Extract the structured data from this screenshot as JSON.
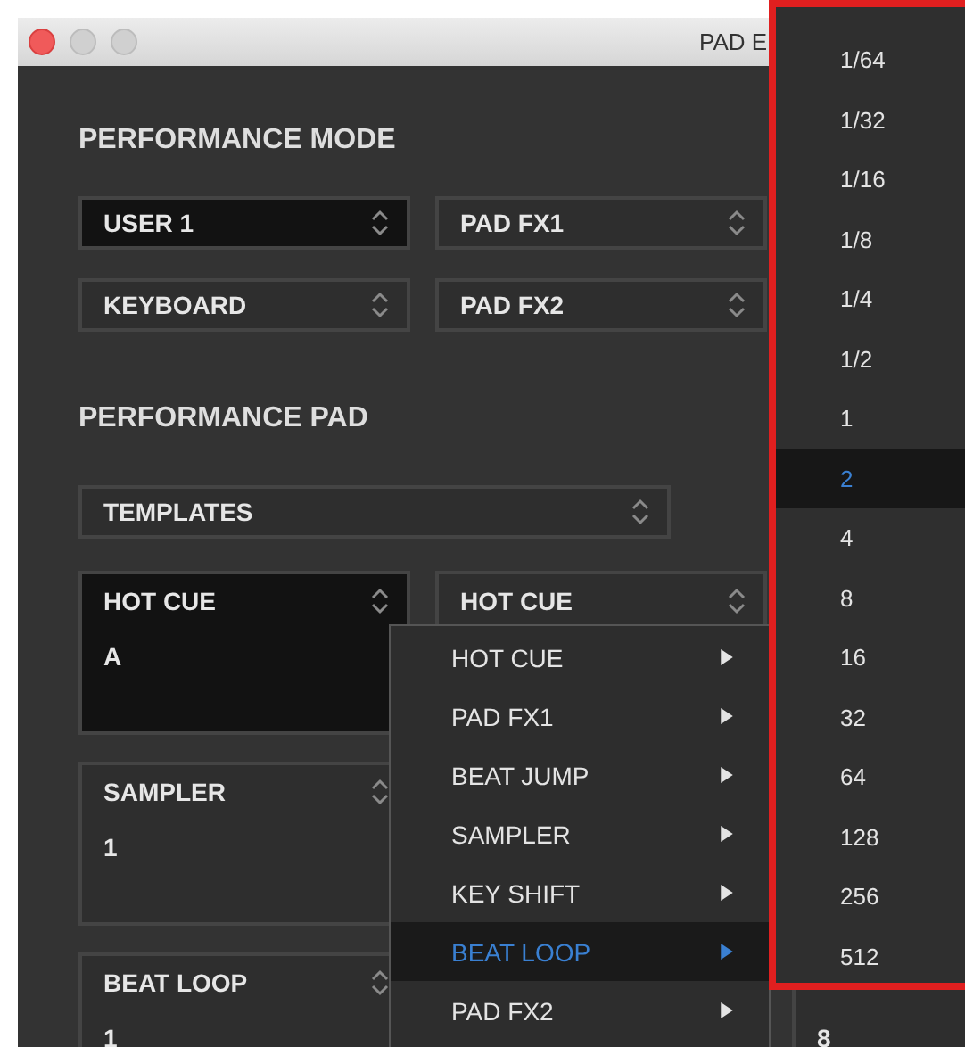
{
  "window": {
    "title": "PAD E"
  },
  "performance_mode": {
    "heading": "PERFORMANCE MODE",
    "selects": [
      {
        "value": "USER 1",
        "selected": true
      },
      {
        "value": "PAD FX1",
        "selected": false
      },
      {
        "value": "KEYBOARD",
        "selected": false
      },
      {
        "value": "PAD FX2",
        "selected": false
      }
    ]
  },
  "performance_pad": {
    "heading": "PERFORMANCE PAD",
    "templates": "TEMPLATES",
    "pad_columns": [
      [
        {
          "mode": "HOT CUE",
          "value": "A",
          "selected": true
        },
        {
          "mode": "SAMPLER",
          "value": "1",
          "selected": false
        },
        {
          "mode": "BEAT LOOP",
          "value": "1",
          "selected": false
        }
      ],
      [
        {
          "mode": "HOT CUE",
          "selected": false
        }
      ],
      [
        {
          "value": "8",
          "selected": false
        }
      ]
    ]
  },
  "pad_mode_menu": {
    "items": [
      {
        "label": "HOT CUE",
        "selected": false
      },
      {
        "label": "PAD FX1",
        "selected": false
      },
      {
        "label": "BEAT JUMP",
        "selected": false
      },
      {
        "label": "SAMPLER",
        "selected": false
      },
      {
        "label": "KEY SHIFT",
        "selected": false
      },
      {
        "label": "BEAT LOOP",
        "selected": true
      },
      {
        "label": "PAD FX2",
        "selected": false
      }
    ]
  },
  "beat_loop_menu": {
    "items": [
      {
        "label": "1/64",
        "selected": false
      },
      {
        "label": "1/32",
        "selected": false
      },
      {
        "label": "1/16",
        "selected": false
      },
      {
        "label": "1/8",
        "selected": false
      },
      {
        "label": "1/4",
        "selected": false
      },
      {
        "label": "1/2",
        "selected": false
      },
      {
        "label": "1",
        "selected": false
      },
      {
        "label": "2",
        "selected": true
      },
      {
        "label": "4",
        "selected": false
      },
      {
        "label": "8",
        "selected": false
      },
      {
        "label": "16",
        "selected": false
      },
      {
        "label": "32",
        "selected": false
      },
      {
        "label": "64",
        "selected": false
      },
      {
        "label": "128",
        "selected": false
      },
      {
        "label": "256",
        "selected": false
      },
      {
        "label": "512",
        "selected": false
      }
    ]
  }
}
